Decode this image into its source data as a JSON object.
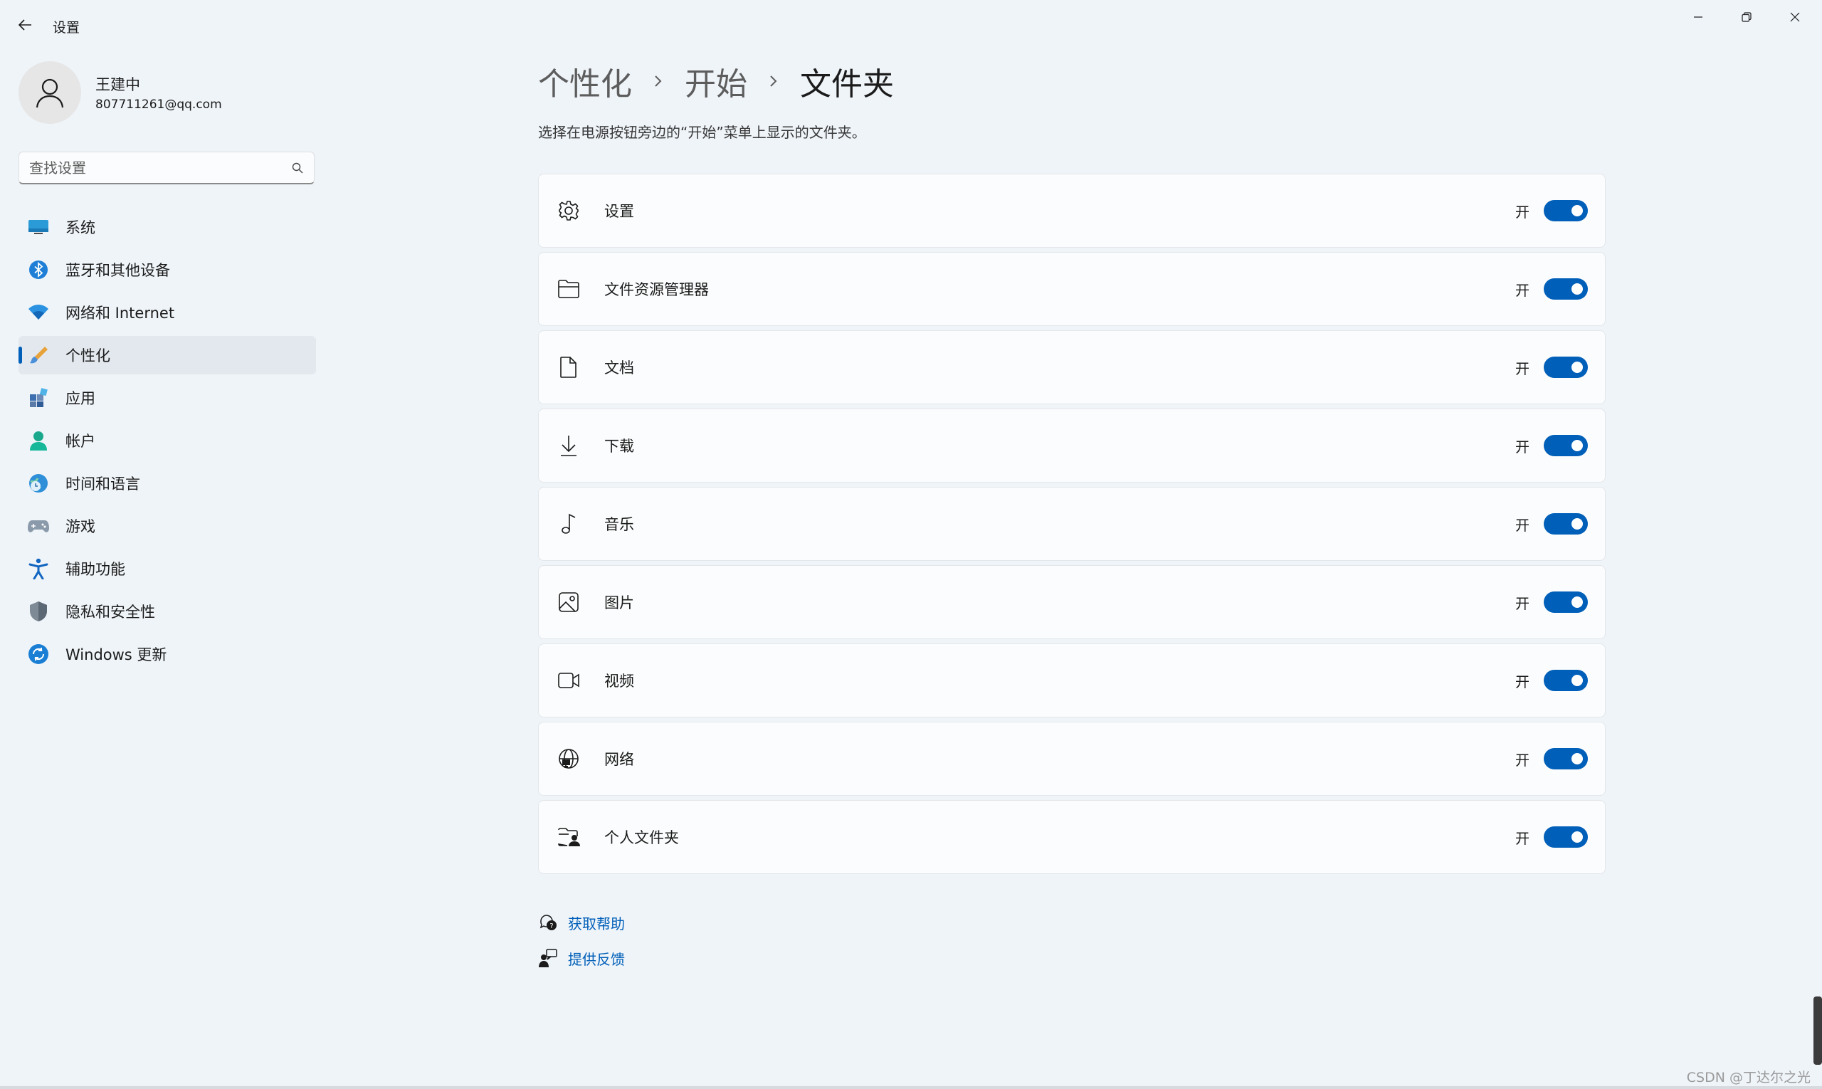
{
  "window": {
    "title": "设置"
  },
  "profile": {
    "name": "王建中",
    "email": "807711261@qq.com"
  },
  "search": {
    "placeholder": "查找设置"
  },
  "sidebar": {
    "items": [
      {
        "label": "系统",
        "icon": "system-icon"
      },
      {
        "label": "蓝牙和其他设备",
        "icon": "bluetooth-icon"
      },
      {
        "label": "网络和 Internet",
        "icon": "wifi-icon"
      },
      {
        "label": "个性化",
        "icon": "paintbrush-icon",
        "selected": true
      },
      {
        "label": "应用",
        "icon": "apps-icon"
      },
      {
        "label": "帐户",
        "icon": "account-icon"
      },
      {
        "label": "时间和语言",
        "icon": "time-language-icon"
      },
      {
        "label": "游戏",
        "icon": "gamepad-icon"
      },
      {
        "label": "辅助功能",
        "icon": "accessibility-icon"
      },
      {
        "label": "隐私和安全性",
        "icon": "shield-icon"
      },
      {
        "label": "Windows 更新",
        "icon": "update-icon"
      }
    ]
  },
  "breadcrumb": {
    "items": [
      "个性化",
      "开始",
      "文件夹"
    ]
  },
  "subtitle": "选择在电源按钮旁边的“开始”菜单上显示的文件夹。",
  "folders": [
    {
      "label": "设置",
      "state": "开",
      "on": true,
      "icon": "gear-icon"
    },
    {
      "label": "文件资源管理器",
      "state": "开",
      "on": true,
      "icon": "folder-open-icon"
    },
    {
      "label": "文档",
      "state": "开",
      "on": true,
      "icon": "document-icon"
    },
    {
      "label": "下载",
      "state": "开",
      "on": true,
      "icon": "download-icon"
    },
    {
      "label": "音乐",
      "state": "开",
      "on": true,
      "icon": "music-note-icon"
    },
    {
      "label": "图片",
      "state": "开",
      "on": true,
      "icon": "image-icon"
    },
    {
      "label": "视频",
      "state": "开",
      "on": true,
      "icon": "video-icon"
    },
    {
      "label": "网络",
      "state": "开",
      "on": true,
      "icon": "network-globe-icon"
    },
    {
      "label": "个人文件夹",
      "state": "开",
      "on": true,
      "icon": "user-folder-icon"
    }
  ],
  "links": {
    "help": "获取帮助",
    "feedback": "提供反馈"
  },
  "watermark": "CSDN @丁达尔之光",
  "colors": {
    "accent": "#005fb8",
    "background": "#eff4f9",
    "card": "#fbfcfd"
  }
}
